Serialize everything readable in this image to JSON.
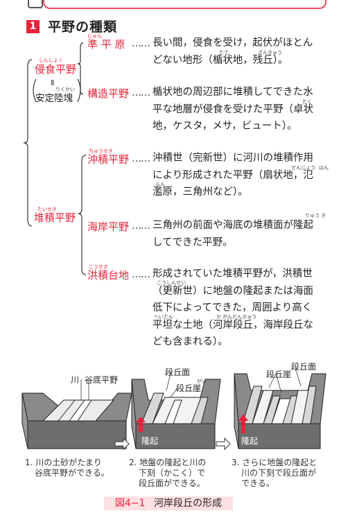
{
  "section": {
    "number": "1",
    "title": "平野の種類"
  },
  "left": {
    "shinshoku": {
      "label": "侵食平野",
      "ruby": "しんしょく"
    },
    "note_symbol": "Ⅱ",
    "note_label": "安定陸塊",
    "note_ruby": "りくかい",
    "taiseki": {
      "label": "堆積平野",
      "ruby": "たいせき"
    }
  },
  "dots": "……",
  "items": [
    {
      "term": "準 平 原",
      "ruby": "じゅん",
      "lines": [
        "長い間，侵食を受け，起伏がほとん",
        "どない地形（楯状地，残丘）。"
      ],
      "rubies": [
        "たて",
        "ざんきゅう"
      ]
    },
    {
      "term": "構造平野",
      "lines": [
        "楯状地の周辺部に堆積してできた水",
        "平な地層が侵食を受けた平野（卓状",
        "地，ケスタ，メサ，ビュート）。"
      ],
      "rubies": [
        "たく"
      ]
    },
    {
      "term": "沖積平野",
      "ruby": "ちゅうせき",
      "lines": [
        "沖積世（完新世）に河川の堆積作用",
        "により形成された平野（扇状地，氾",
        "濫原，三角州など）。"
      ],
      "rubies": [
        "せんじょう",
        "はん",
        "らん"
      ]
    },
    {
      "term": "海岸平野",
      "lines": [
        "三角州の前面や海底の堆積面が隆起",
        "してできた平野。"
      ],
      "rubies": [
        "りゅう き"
      ]
    },
    {
      "term": "洪積台地",
      "ruby": "こうせき",
      "lines": [
        "形成されていた堆積平野が，洪積世",
        "（更新世）に地盤の隆起または海面",
        "低下によってできた，周囲より高く",
        "平坦な土地（河岸段丘，海岸段丘な",
        "ども含まれる）。"
      ],
      "rubies": [
        "こうしんせい",
        "へいたん",
        "か がんだんきゅう"
      ]
    }
  ],
  "figure": {
    "labels": {
      "river": "川",
      "valley_plain": "谷底平野",
      "terrace_surface": "段丘面",
      "terrace_cliff": "段丘崖",
      "terrace_cliff_ruby": "がい",
      "uplift": "隆起"
    },
    "captions": [
      [
        "1. 川の土砂がたまり",
        "谷底平野ができる。"
      ],
      [
        "2. 地盤の隆起と川の",
        "下刻（かこく）で",
        "段丘面ができる。"
      ],
      [
        "3. さらに地盤の隆起と",
        "川の下刻で段丘面が",
        "できる。"
      ]
    ],
    "title_num": "図4−1",
    "title": "河岸段丘の形成"
  }
}
